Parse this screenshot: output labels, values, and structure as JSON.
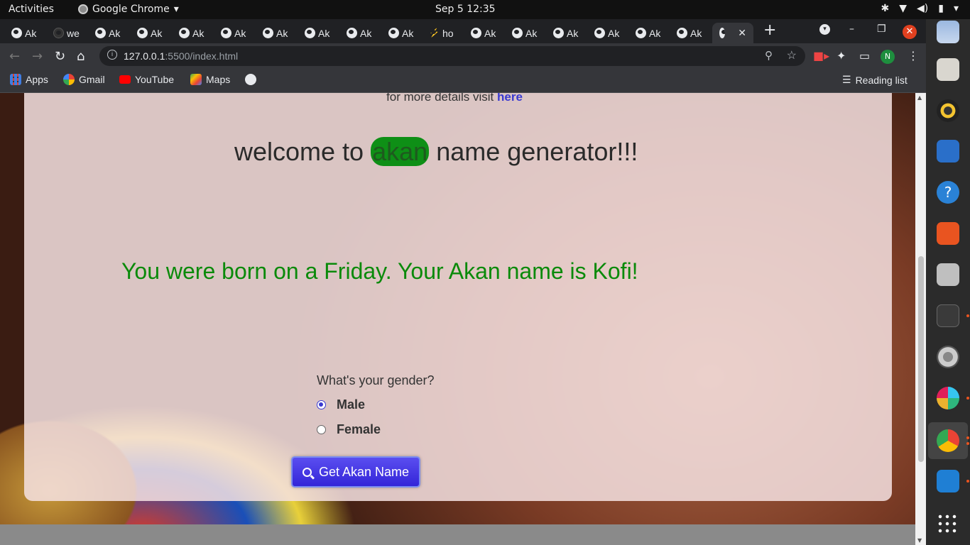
{
  "system_bar": {
    "activities": "Activities",
    "app_name": "Google Chrome",
    "clock": "Sep 5  12:35"
  },
  "tabs": [
    {
      "label": "Ak"
    },
    {
      "label": "we"
    },
    {
      "label": "Ak"
    },
    {
      "label": "Ak"
    },
    {
      "label": "Ak"
    },
    {
      "label": "Ak"
    },
    {
      "label": "Ak"
    },
    {
      "label": "Ak"
    },
    {
      "label": "Ak"
    },
    {
      "label": "Ak"
    },
    {
      "label": "ho"
    },
    {
      "label": "Ak"
    },
    {
      "label": "Ak"
    },
    {
      "label": "Ak"
    },
    {
      "label": "Ak"
    },
    {
      "label": "Ak"
    },
    {
      "label": "Ak"
    }
  ],
  "address_bar": {
    "host": "127.0.0.1",
    "path": ":5500/index.html"
  },
  "profile_initial": "N",
  "bookmarks": {
    "apps": "Apps",
    "gmail": "Gmail",
    "youtube": "YouTube",
    "maps": "Maps",
    "reading_list": "Reading list"
  },
  "page": {
    "details_text": "for more details visit",
    "details_link": "here",
    "welcome_pre": "welcome to",
    "welcome_highlight": "akan",
    "welcome_post": "name generator!!!",
    "result": "You were born on a Friday. Your Akan name is Kofi!",
    "gender_question": "What's your gender?",
    "gender_options": [
      "Male",
      "Female"
    ],
    "gender_selected": "Male",
    "submit_label": "Get Akan Name"
  },
  "colors": {
    "result_text": "#0a8a0a",
    "highlight_bg": "#0e8f16",
    "link": "#3a3ad0",
    "button": "#3325d8"
  }
}
